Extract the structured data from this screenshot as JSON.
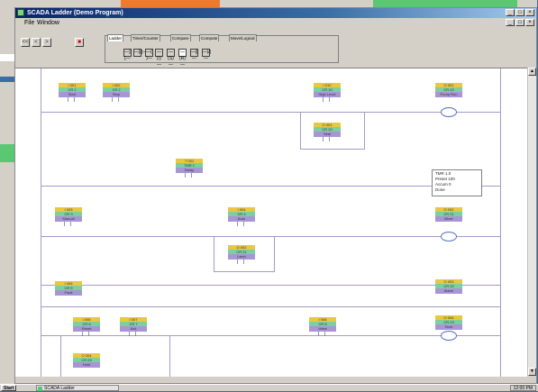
{
  "window": {
    "title": "SCADA Ladder (Demo Program)"
  },
  "menu": {
    "file": "File",
    "window": "Window"
  },
  "toolbar": {
    "nav_buttons": [
      "<<",
      "<",
      ">"
    ],
    "stop_symbol": "■",
    "tabs": [
      "Ladder",
      "Timer/Counter",
      "Compare",
      "Compute",
      "Move/Logical"
    ],
    "instruction_symbols": [
      "—]  [—",
      "—]/[—",
      "—( )—",
      "—(/)—",
      "—(S)—",
      "—(R)—",
      "—||—",
      "—|/|—"
    ]
  },
  "ladder": {
    "contact_glyph": "| |",
    "blocks": [
      {
        "id": "r1-c1",
        "tag": "I 001",
        "addr": "CR 1",
        "label": "Start"
      },
      {
        "id": "r1-c2",
        "tag": "I 002",
        "addr": "CR 2",
        "label": "Stop"
      },
      {
        "id": "r1-c3",
        "tag": "I 010",
        "addr": "CR 10",
        "label": "High Level"
      },
      {
        "id": "r1-c4",
        "tag": "O 001",
        "addr": "CR 20",
        "label": "Pump Run"
      },
      {
        "id": "r1-b1",
        "tag": "O 001",
        "addr": "CR 20",
        "label": "Seal"
      },
      {
        "id": "r2-c1",
        "tag": "T 001",
        "addr": "TMR 1",
        "label": "Delay"
      },
      {
        "id": "r3-c1",
        "tag": "I 003",
        "addr": "CR 3",
        "label": "Manual"
      },
      {
        "id": "r3-c2",
        "tag": "I 004",
        "addr": "CR 4",
        "label": "Auto"
      },
      {
        "id": "r3-c3",
        "tag": "O 002",
        "addr": "CR 21",
        "label": "Mixer"
      },
      {
        "id": "r3-b1",
        "tag": "O 002",
        "addr": "CR 21",
        "label": "Latch"
      },
      {
        "id": "r4-c1",
        "tag": "I 005",
        "addr": "CR 5",
        "label": "Fault"
      },
      {
        "id": "r4-c2",
        "tag": "O 003",
        "addr": "CR 22",
        "label": "Alarm"
      },
      {
        "id": "r5-c1",
        "tag": "I 006",
        "addr": "CR 6",
        "label": "Reset"
      },
      {
        "id": "r5-c2",
        "tag": "I 007",
        "addr": "CR 7",
        "label": "Ack"
      },
      {
        "id": "r5-c3",
        "tag": "I 008",
        "addr": "CR 8",
        "label": "Valve"
      },
      {
        "id": "r5-c4",
        "tag": "O 004",
        "addr": "CR 23",
        "label": "Horn"
      },
      {
        "id": "r5-b1",
        "tag": "O 004",
        "addr": "CR 23",
        "label": "Hold"
      }
    ],
    "timer_note": {
      "line1": "TMR   1.0",
      "line2": "Preset    100",
      "line3": "Accum   0",
      "line4": "Done"
    }
  },
  "taskbar": {
    "start": "Start",
    "task": "SCADA Ladder",
    "clock": "12:00 PM"
  }
}
